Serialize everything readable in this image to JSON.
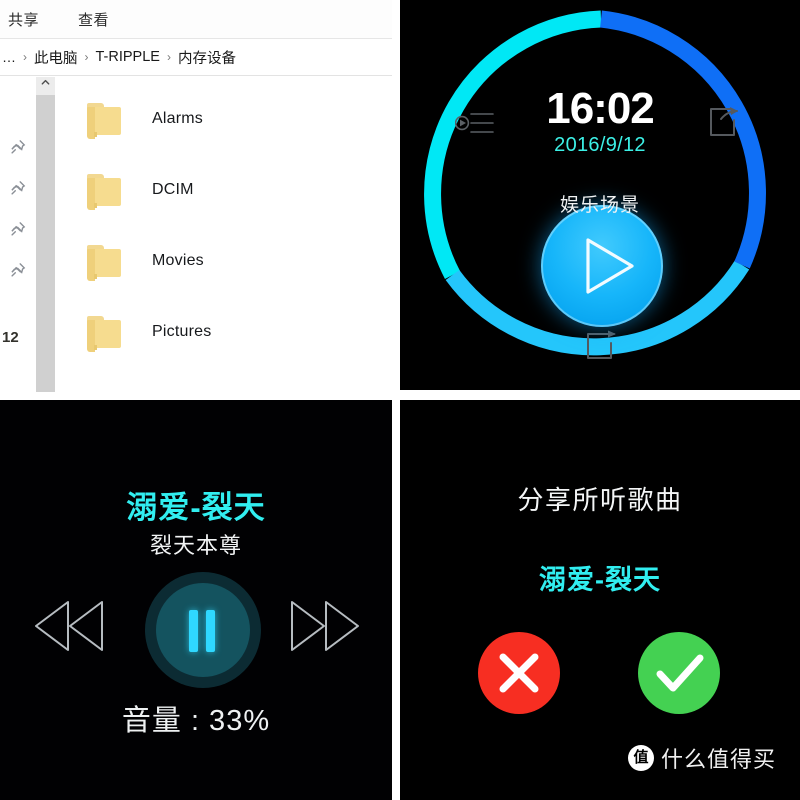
{
  "explorer": {
    "menu_tabs": [
      {
        "label": "共享",
        "name": "menu-tab-share"
      },
      {
        "label": "查看",
        "name": "menu-tab-view"
      }
    ],
    "breadcrumb": {
      "clipped_prefix": "…",
      "separator": "›",
      "items": [
        "此电脑",
        "T-RIPPLE",
        "内存设备"
      ]
    },
    "nav_rail": {
      "pin_count": 4,
      "pin_icon": "pin-icon",
      "count_label": "12",
      "scroll_up_icon": "chevron-up-icon"
    },
    "files": [
      {
        "name": "Alarms",
        "type": "folder"
      },
      {
        "name": "DCIM",
        "type": "folder"
      },
      {
        "name": "Movies",
        "type": "folder"
      },
      {
        "name": "Pictures",
        "type": "folder"
      }
    ]
  },
  "watch": {
    "time": "16:02",
    "date": "2016/9/12",
    "scene_label": "娱乐场景",
    "icons": {
      "playlist": "playlist-icon",
      "share": "share-arrow-icon",
      "loop": "loop-arrow-icon",
      "play": "play-icon"
    },
    "ring_colors": {
      "top_left_cyan": "#00E8F5",
      "right_blue": "#0F6FF6",
      "bottom_sky": "#24C6FB"
    },
    "accent": "#3CF0E6"
  },
  "player": {
    "title": "溺爱-裂天",
    "artist": "裂天本尊",
    "volume_label": "音量 : 33%",
    "volume_percent": 33,
    "icons": {
      "previous": "rewind-icon",
      "pause": "pause-icon",
      "next": "fast-forward-icon"
    },
    "accent": "#31EEF0"
  },
  "share": {
    "title": "分享所听歌曲",
    "song": "溺爱-裂天",
    "reject_icon": "close-x-icon",
    "accept_icon": "check-icon",
    "reject_color": "#F72E22",
    "accept_color": "#44D152",
    "watermark": {
      "badge": "值",
      "text": "什么值得买"
    }
  }
}
